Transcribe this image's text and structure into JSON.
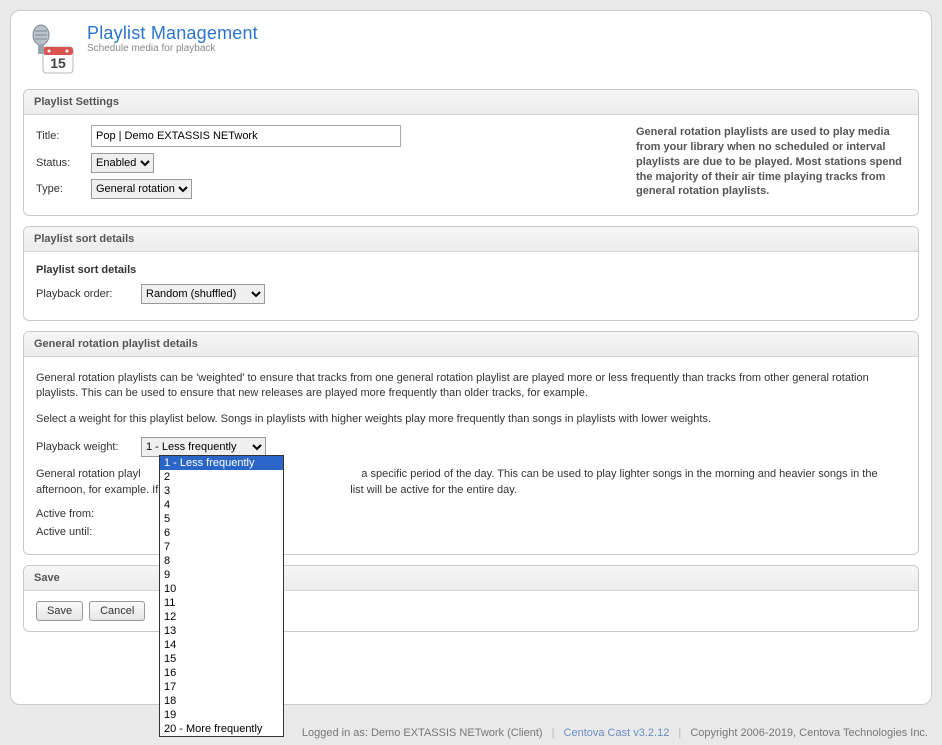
{
  "header": {
    "title": "Playlist Management",
    "subtitle": "Schedule media for playback"
  },
  "settings": {
    "title": "Playlist Settings",
    "labels": {
      "title": "Title:",
      "status": "Status:",
      "type": "Type:"
    },
    "title_value": "Pop | Demo EXTASSIS NETwork",
    "status_value": "Enabled",
    "type_value": "General rotation",
    "help": "General rotation playlists are used to play media from your library when no scheduled or interval playlists are due to be played. Most stations spend the majority of their air time playing tracks from general rotation playlists."
  },
  "sort": {
    "title": "Playlist sort details",
    "subtitle": "Playlist sort details",
    "label": "Playback order:",
    "value": "Random (shuffled)"
  },
  "rotation": {
    "title": "General rotation playlist details",
    "para1": "General rotation playlists can be 'weighted' to ensure that tracks from one general rotation playlist are played more or less frequently than tracks from other general rotation playlists. This can be used to ensure that new releases are played more frequently than older tracks, for example.",
    "para2": "Select a weight for this playlist below. Songs in playlists with higher weights play more frequently than songs in playlists with lower weights.",
    "weight_label": "Playback weight:",
    "weight_value": "1 - Less frequently",
    "weight_options": [
      "1 - Less frequently",
      "2",
      "3",
      "4",
      "5",
      "6",
      "7",
      "8",
      "9",
      "10",
      "11",
      "12",
      "13",
      "14",
      "15",
      "16",
      "17",
      "18",
      "19",
      "20 - More frequently"
    ],
    "para3a": "General rotation playl",
    "para3b": " a specific period of the day. This can be used to play lighter songs in the morning and heavier songs in the afternoon, for example. If no time p",
    "para3c": "list will be active for the entire day.",
    "active_from_label": "Active from:",
    "active_until_label": "Active until:"
  },
  "save": {
    "title": "Save",
    "save_btn": "Save",
    "cancel_btn": "Cancel"
  },
  "footer": {
    "logged": "Logged in as: Demo EXTASSIS NETwork (Client)",
    "product": "Centova Cast v3.2.12",
    "copyright": "Copyright 2006-2019, Centova Technologies Inc."
  }
}
